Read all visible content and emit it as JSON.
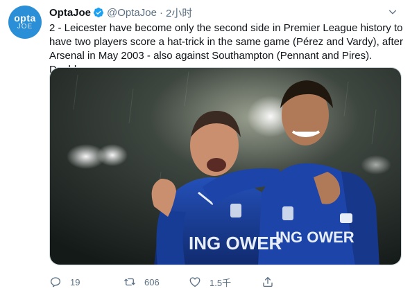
{
  "author": {
    "avatar_line1": "opta",
    "avatar_line2": "JOE",
    "name": "OptaJoe",
    "handle": "@OptaJoe",
    "separator": "·",
    "time": "2小时"
  },
  "tweet": {
    "text": "2 - Leicester have become only the second side in Premier League history to have two players score a hat-trick in the same game (Pérez and Vardy), after Arsenal in May 2003 - also against Southampton (Pennant and Pires). Double."
  },
  "media": {
    "shirt_text_left": "ING OWER",
    "shirt_text_right": "ING OWER"
  },
  "actions": {
    "replies": "19",
    "retweets": "606",
    "likes": "1.5千"
  },
  "colors": {
    "accent": "#1da1f2",
    "muted": "#5b7083",
    "avatar": "#2a8fd6",
    "kit": "#1a3f9c"
  }
}
